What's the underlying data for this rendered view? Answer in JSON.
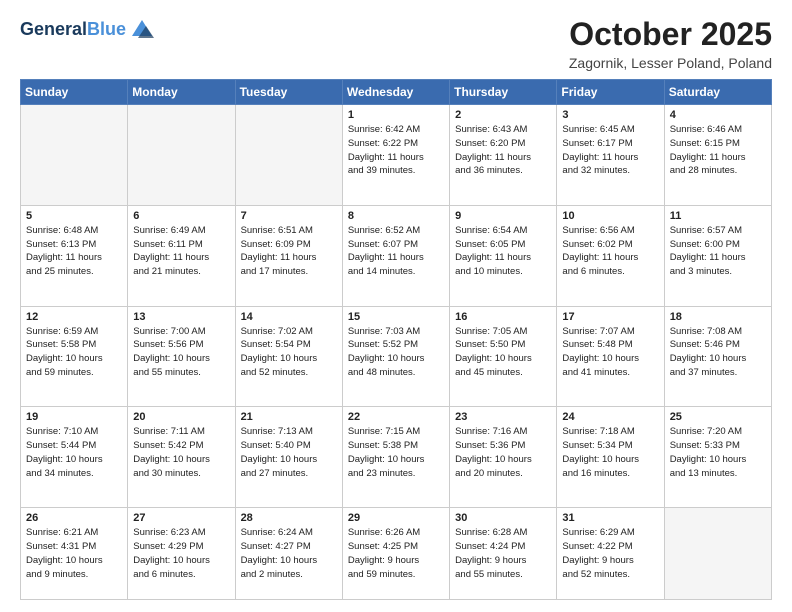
{
  "header": {
    "logo_line1": "General",
    "logo_line2": "Blue",
    "month": "October 2025",
    "location": "Zagornik, Lesser Poland, Poland"
  },
  "weekdays": [
    "Sunday",
    "Monday",
    "Tuesday",
    "Wednesday",
    "Thursday",
    "Friday",
    "Saturday"
  ],
  "weeks": [
    [
      {
        "day": "",
        "info": ""
      },
      {
        "day": "",
        "info": ""
      },
      {
        "day": "",
        "info": ""
      },
      {
        "day": "1",
        "info": "Sunrise: 6:42 AM\nSunset: 6:22 PM\nDaylight: 11 hours\nand 39 minutes."
      },
      {
        "day": "2",
        "info": "Sunrise: 6:43 AM\nSunset: 6:20 PM\nDaylight: 11 hours\nand 36 minutes."
      },
      {
        "day": "3",
        "info": "Sunrise: 6:45 AM\nSunset: 6:17 PM\nDaylight: 11 hours\nand 32 minutes."
      },
      {
        "day": "4",
        "info": "Sunrise: 6:46 AM\nSunset: 6:15 PM\nDaylight: 11 hours\nand 28 minutes."
      }
    ],
    [
      {
        "day": "5",
        "info": "Sunrise: 6:48 AM\nSunset: 6:13 PM\nDaylight: 11 hours\nand 25 minutes."
      },
      {
        "day": "6",
        "info": "Sunrise: 6:49 AM\nSunset: 6:11 PM\nDaylight: 11 hours\nand 21 minutes."
      },
      {
        "day": "7",
        "info": "Sunrise: 6:51 AM\nSunset: 6:09 PM\nDaylight: 11 hours\nand 17 minutes."
      },
      {
        "day": "8",
        "info": "Sunrise: 6:52 AM\nSunset: 6:07 PM\nDaylight: 11 hours\nand 14 minutes."
      },
      {
        "day": "9",
        "info": "Sunrise: 6:54 AM\nSunset: 6:05 PM\nDaylight: 11 hours\nand 10 minutes."
      },
      {
        "day": "10",
        "info": "Sunrise: 6:56 AM\nSunset: 6:02 PM\nDaylight: 11 hours\nand 6 minutes."
      },
      {
        "day": "11",
        "info": "Sunrise: 6:57 AM\nSunset: 6:00 PM\nDaylight: 11 hours\nand 3 minutes."
      }
    ],
    [
      {
        "day": "12",
        "info": "Sunrise: 6:59 AM\nSunset: 5:58 PM\nDaylight: 10 hours\nand 59 minutes."
      },
      {
        "day": "13",
        "info": "Sunrise: 7:00 AM\nSunset: 5:56 PM\nDaylight: 10 hours\nand 55 minutes."
      },
      {
        "day": "14",
        "info": "Sunrise: 7:02 AM\nSunset: 5:54 PM\nDaylight: 10 hours\nand 52 minutes."
      },
      {
        "day": "15",
        "info": "Sunrise: 7:03 AM\nSunset: 5:52 PM\nDaylight: 10 hours\nand 48 minutes."
      },
      {
        "day": "16",
        "info": "Sunrise: 7:05 AM\nSunset: 5:50 PM\nDaylight: 10 hours\nand 45 minutes."
      },
      {
        "day": "17",
        "info": "Sunrise: 7:07 AM\nSunset: 5:48 PM\nDaylight: 10 hours\nand 41 minutes."
      },
      {
        "day": "18",
        "info": "Sunrise: 7:08 AM\nSunset: 5:46 PM\nDaylight: 10 hours\nand 37 minutes."
      }
    ],
    [
      {
        "day": "19",
        "info": "Sunrise: 7:10 AM\nSunset: 5:44 PM\nDaylight: 10 hours\nand 34 minutes."
      },
      {
        "day": "20",
        "info": "Sunrise: 7:11 AM\nSunset: 5:42 PM\nDaylight: 10 hours\nand 30 minutes."
      },
      {
        "day": "21",
        "info": "Sunrise: 7:13 AM\nSunset: 5:40 PM\nDaylight: 10 hours\nand 27 minutes."
      },
      {
        "day": "22",
        "info": "Sunrise: 7:15 AM\nSunset: 5:38 PM\nDaylight: 10 hours\nand 23 minutes."
      },
      {
        "day": "23",
        "info": "Sunrise: 7:16 AM\nSunset: 5:36 PM\nDaylight: 10 hours\nand 20 minutes."
      },
      {
        "day": "24",
        "info": "Sunrise: 7:18 AM\nSunset: 5:34 PM\nDaylight: 10 hours\nand 16 minutes."
      },
      {
        "day": "25",
        "info": "Sunrise: 7:20 AM\nSunset: 5:33 PM\nDaylight: 10 hours\nand 13 minutes."
      }
    ],
    [
      {
        "day": "26",
        "info": "Sunrise: 6:21 AM\nSunset: 4:31 PM\nDaylight: 10 hours\nand 9 minutes."
      },
      {
        "day": "27",
        "info": "Sunrise: 6:23 AM\nSunset: 4:29 PM\nDaylight: 10 hours\nand 6 minutes."
      },
      {
        "day": "28",
        "info": "Sunrise: 6:24 AM\nSunset: 4:27 PM\nDaylight: 10 hours\nand 2 minutes."
      },
      {
        "day": "29",
        "info": "Sunrise: 6:26 AM\nSunset: 4:25 PM\nDaylight: 9 hours\nand 59 minutes."
      },
      {
        "day": "30",
        "info": "Sunrise: 6:28 AM\nSunset: 4:24 PM\nDaylight: 9 hours\nand 55 minutes."
      },
      {
        "day": "31",
        "info": "Sunrise: 6:29 AM\nSunset: 4:22 PM\nDaylight: 9 hours\nand 52 minutes."
      },
      {
        "day": "",
        "info": ""
      }
    ]
  ]
}
